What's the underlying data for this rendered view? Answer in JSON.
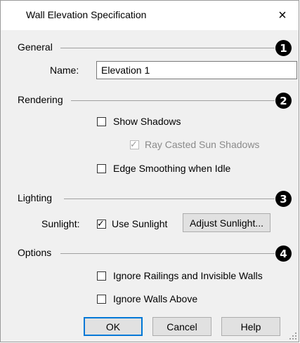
{
  "dialog": {
    "title": "Wall Elevation Specification",
    "close_glyph": "×"
  },
  "sections": {
    "general": {
      "label": "General",
      "callout": "1"
    },
    "rendering": {
      "label": "Rendering",
      "callout": "2"
    },
    "lighting": {
      "label": "Lighting",
      "callout": "3"
    },
    "options": {
      "label": "Options",
      "callout": "4"
    }
  },
  "general": {
    "name_label": "Name:",
    "name_value": "Elevation 1"
  },
  "rendering": {
    "show_shadows": {
      "label": "Show Shadows",
      "checked": false
    },
    "ray_casted": {
      "label": "Ray Casted Sun Shadows",
      "checked": true,
      "disabled": true
    },
    "edge_smoothing": {
      "label": "Edge Smoothing when Idle",
      "checked": false
    }
  },
  "lighting": {
    "sunlight_label": "Sunlight:",
    "use_sunlight": {
      "label": "Use Sunlight",
      "checked": true
    },
    "adjust_button": "Adjust Sunlight..."
  },
  "options": {
    "ignore_railings": {
      "label": "Ignore Railings and Invisible Walls",
      "checked": false
    },
    "ignore_walls_above": {
      "label": "Ignore Walls Above",
      "checked": false
    }
  },
  "buttons": {
    "ok": "OK",
    "cancel": "Cancel",
    "help": "Help"
  },
  "colors": {
    "dialog_bg": "#f0f0f0",
    "default_button_border": "#0078d7",
    "callout_bg": "#000000"
  }
}
